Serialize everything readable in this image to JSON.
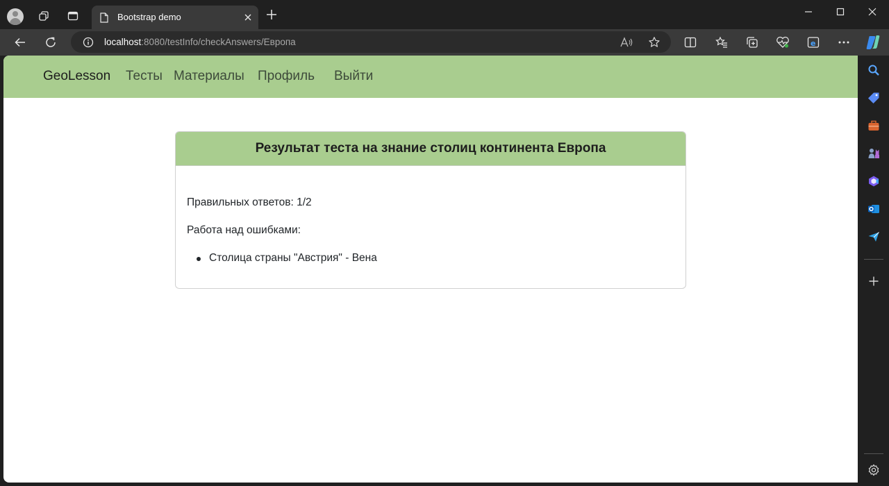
{
  "browser": {
    "tab_title": "Bootstrap demo",
    "url_host": "localhost",
    "url_rest": ":8080/testInfo/checkAnswers/Европа"
  },
  "site": {
    "brand": "GeoLesson",
    "nav": [
      "Тесты",
      "Материалы",
      "Профиль",
      "Выйти"
    ]
  },
  "card": {
    "title": "Результат теста на знание столиц континента Европа",
    "correct_label": "Правильных ответов: 1/2",
    "errors_label": "Работа над ошибками:",
    "errors": [
      "Столица страны \"Австрия\" - Вена"
    ]
  },
  "colors": {
    "navbar": "#a9cd8f",
    "card_header": "#a9cd8f",
    "browser_dark": "#202020"
  }
}
